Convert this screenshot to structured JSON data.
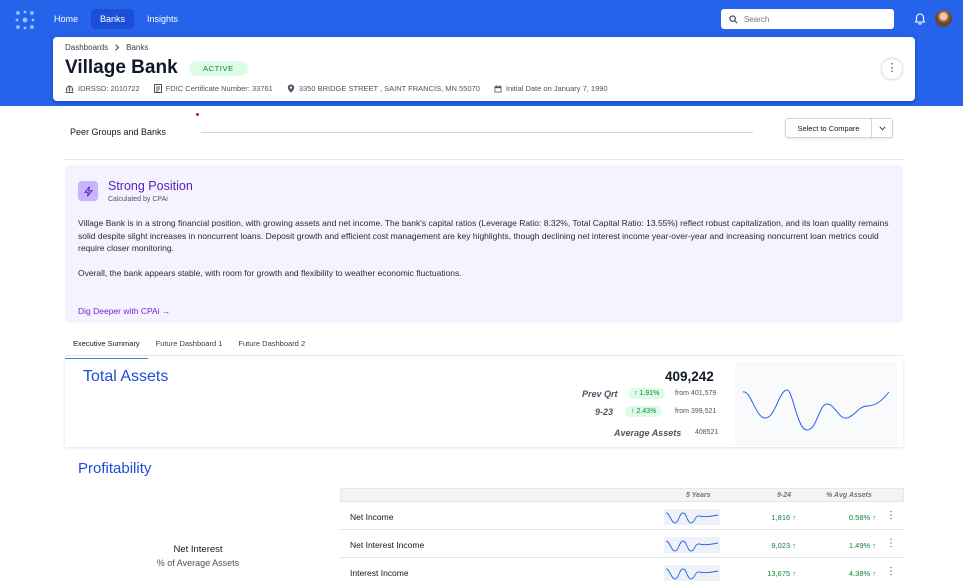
{
  "nav": {
    "items": [
      "Home",
      "Banks",
      "Insights"
    ],
    "active_index": 1
  },
  "search": {
    "placeholder": "Search"
  },
  "header": {
    "breadcrumb": [
      "Dashboards",
      "Banks"
    ],
    "bank_name": "Village Bank",
    "status": "ACTIVE",
    "meta": {
      "idrssd": "IDRSSD: 2010722",
      "fdic": "FDIC Certificate Number: 33761",
      "address": "3350 BRIDGE STREET , SAINT FRANCIS, MN 55070",
      "initial_date": "Initial Date on January 7, 1990"
    }
  },
  "peer_groups": {
    "label": "Peer Groups and Banks",
    "select_label": "Select  to Compare"
  },
  "cpai": {
    "title": "Strong Position",
    "subtitle": "Calculated by CPAi",
    "paragraph_1": "Village Bank is in a strong financial position, with growing assets and net income. The bank's capital ratios (Leverage Ratio: 8.32%, Total Capital Ratio: 13.55%) reflect robust capitalization, and its loan quality remains solid despite slight increases in noncurrent loans. Deposit growth and efficient cost management are key highlights, though declining net interest income year-over-year and increasing noncurrent loan metrics could require closer monitoring.",
    "paragraph_2": "Overall, the bank appears stable, with room for growth and flexibility to weather economic fluctuations.",
    "link": "Dig Deeper with CPAi →"
  },
  "tabs": [
    "Executive Summary",
    "Future Dashboard 1",
    "Future Dashboard 2"
  ],
  "total_assets": {
    "title": "Total Assets",
    "value": "409,242",
    "prev_qrt_label": "Prev Qrt",
    "prev_qrt_pct": "↑ 1.91%",
    "prev_qrt_from": "from 401,579",
    "yoy_label": "9-23",
    "yoy_pct": "↑ 2.43%",
    "yoy_from": "from 399,521",
    "avg_label": "Average Assets",
    "avg_value": "408521"
  },
  "profitability": {
    "title": "Profitability",
    "chart_title": "Net Interest",
    "chart_subtitle": "% of Average Assets",
    "columns": [
      "5 Years",
      "9-24",
      "% Avg Assets"
    ],
    "rows": [
      {
        "name": "Net Income",
        "value": "1,816 ↑",
        "pct": "0.58% ↑"
      },
      {
        "name": "Net Interest Income",
        "value": "9,023 ↑",
        "pct": "1.49% ↑"
      },
      {
        "name": "Interest Income",
        "value": "13,675 ↑",
        "pct": "4.38% ↑"
      }
    ]
  },
  "colors": {
    "brand": "#2563eb",
    "accent_purple": "#5b21b6",
    "positive": "#15803d"
  }
}
